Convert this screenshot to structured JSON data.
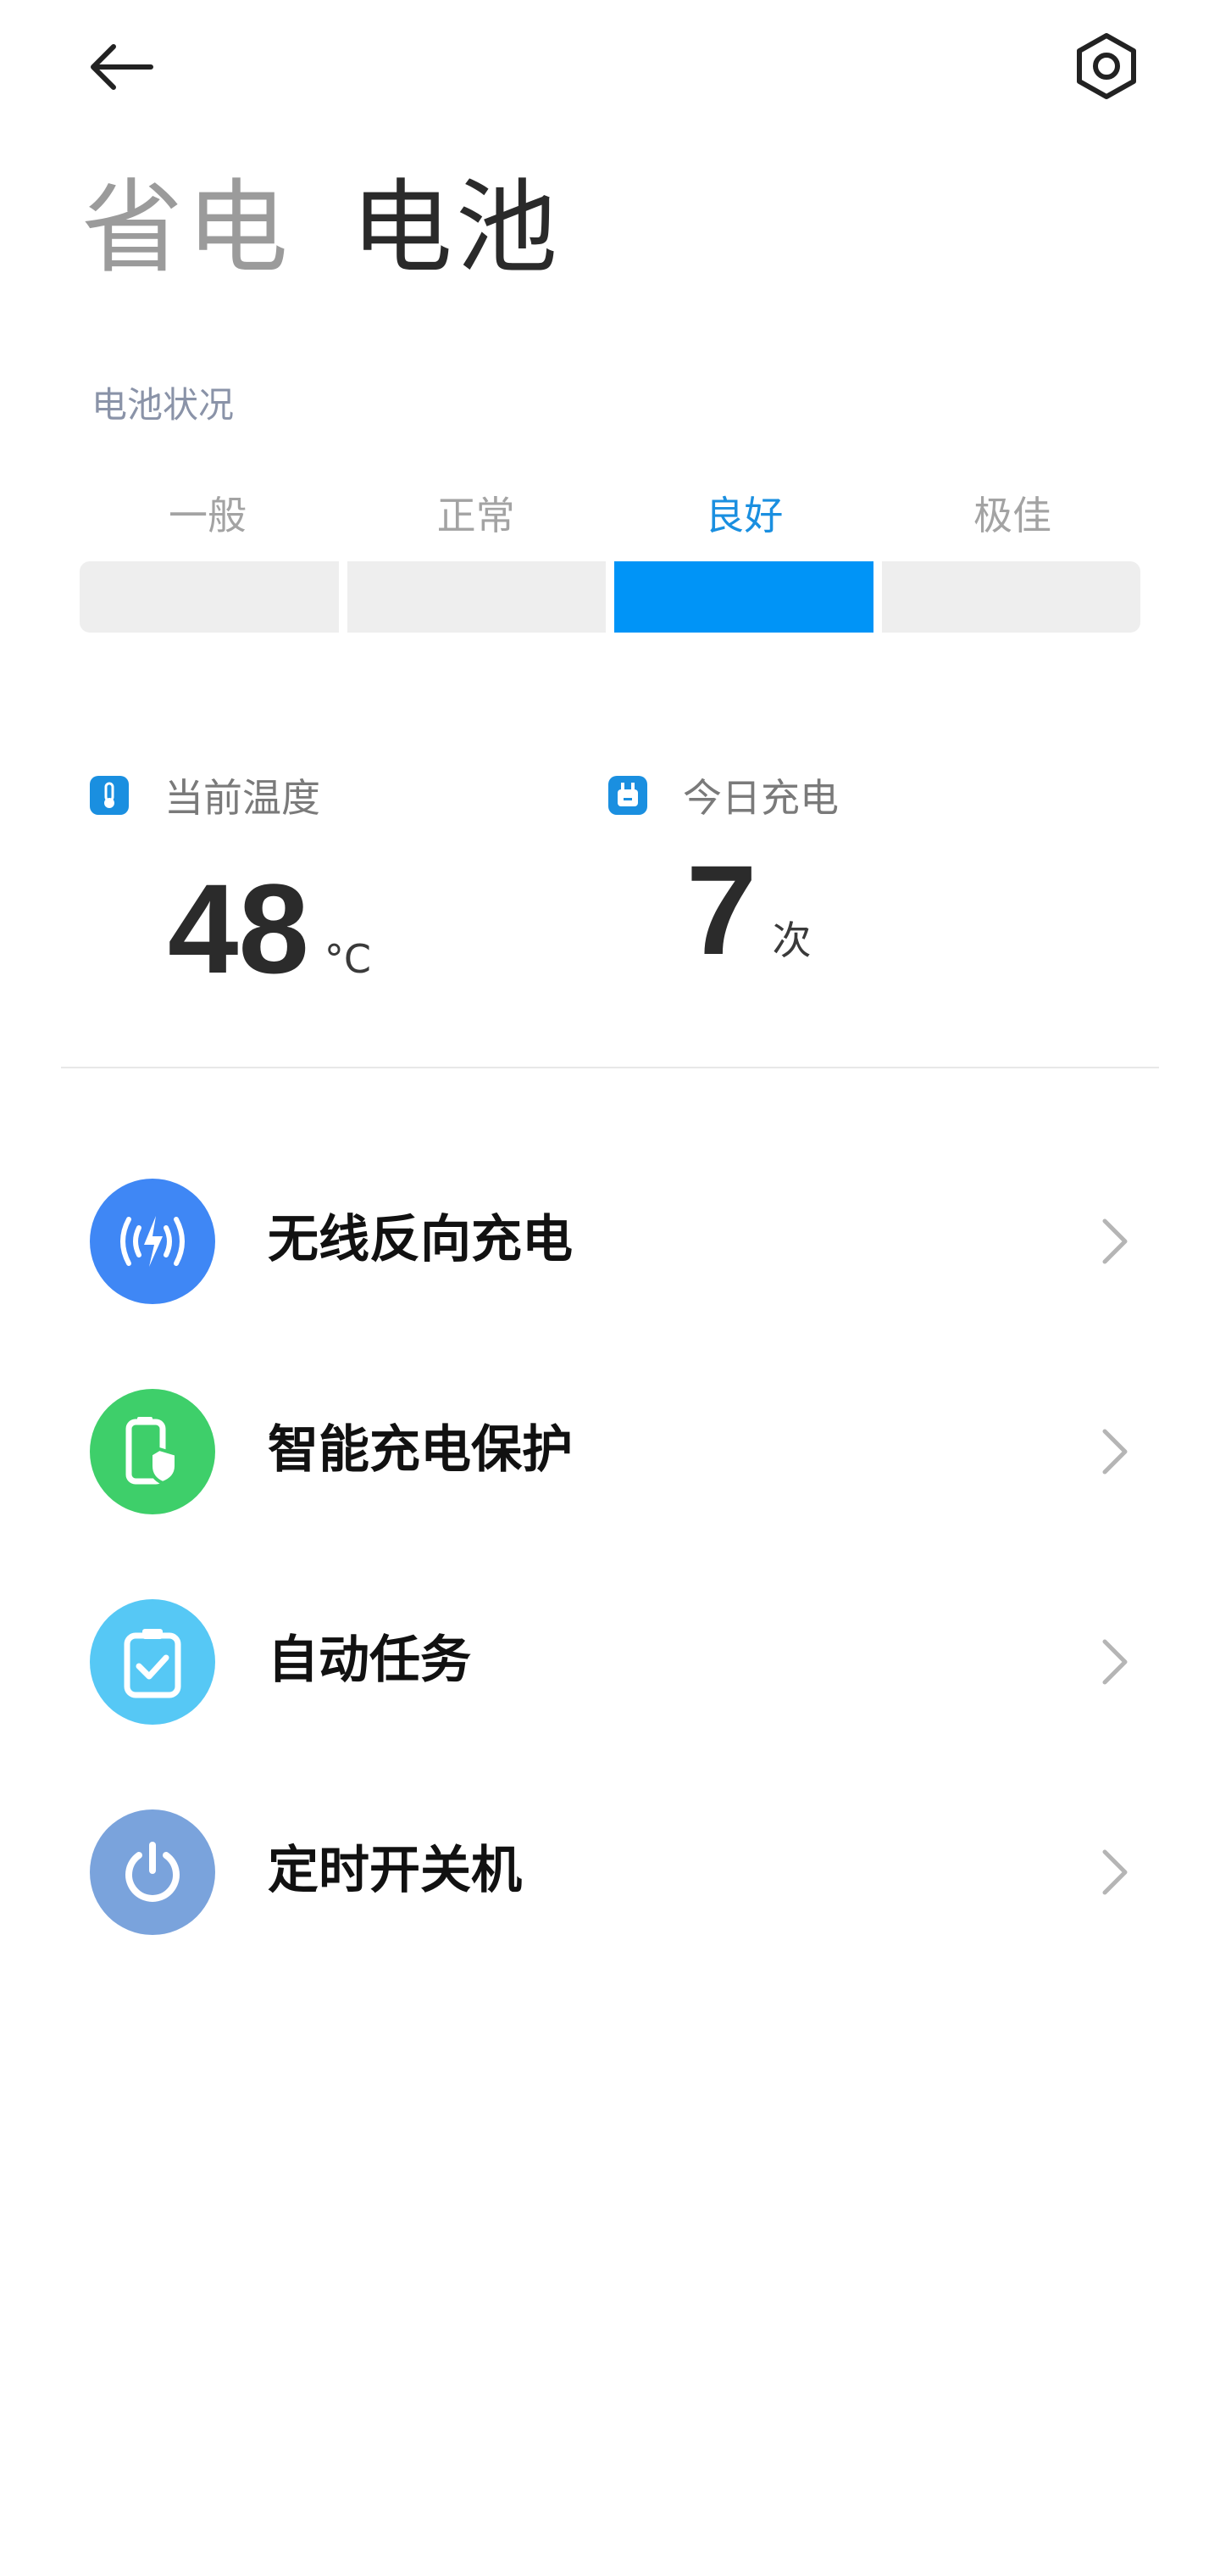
{
  "tabs": [
    {
      "label": "省电",
      "active": false
    },
    {
      "label": "电池",
      "active": true
    }
  ],
  "battery_condition": {
    "label": "电池状况",
    "levels": [
      "一般",
      "正常",
      "良好",
      "极佳"
    ],
    "current_level": "良好"
  },
  "stats": {
    "temperature": {
      "title": "当前温度",
      "value": "48",
      "unit": "°C"
    },
    "charges_today": {
      "title": "今日充电",
      "value": "7",
      "unit": "次"
    }
  },
  "menu": [
    {
      "label": "无线反向充电",
      "icon": "wireless-reverse-charge-icon",
      "color": "#3f87f5"
    },
    {
      "label": "智能充电保护",
      "icon": "battery-shield-icon",
      "color": "#3ecf6a"
    },
    {
      "label": "自动任务",
      "icon": "clipboard-check-icon",
      "color": "#56c8f5"
    },
    {
      "label": "定时开关机",
      "icon": "power-icon",
      "color": "#7aa3dc"
    }
  ],
  "colors": {
    "accent": "#0094f7",
    "inactive_segment": "#eeeeee"
  }
}
